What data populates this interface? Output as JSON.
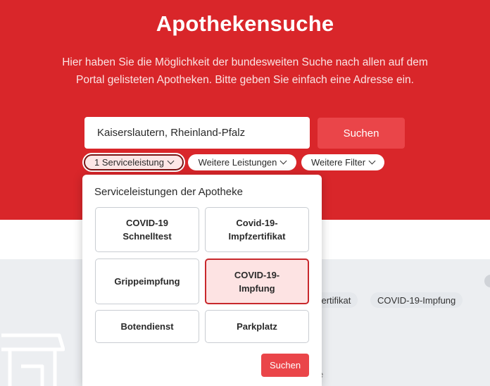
{
  "header": {
    "title": "Apothekensuche",
    "description_line1": "Hier haben Sie die Möglichkeit der bundesweiten Suche nach allen auf dem",
    "description_line2": "Portal gelisteten Apotheken. Bitte geben Sie einfach eine Adresse ein."
  },
  "search": {
    "value": "Kaiserslautern, Rheinland-Pfalz",
    "placeholder": "",
    "button_label": "Suchen"
  },
  "filters": [
    {
      "label": "1 Serviceleistung",
      "active": true,
      "icon": "chevron-down-icon"
    },
    {
      "label": "Weitere Leistungen",
      "active": false,
      "icon": "chevron-down-icon"
    },
    {
      "label": "Weitere Filter",
      "active": false,
      "icon": "chevron-down-icon"
    }
  ],
  "dropdown": {
    "title": "Serviceleistungen der Apotheke",
    "options": [
      {
        "line1": "COVID-19",
        "line2": "Schnelltest",
        "selected": false
      },
      {
        "line1": "Covid-19-",
        "line2": "Impfzertifikat",
        "selected": false
      },
      {
        "line1": "Grippeimpfung",
        "line2": "",
        "selected": false
      },
      {
        "line1": "COVID-19-",
        "line2": "Impfung",
        "selected": true
      },
      {
        "line1": "Botendienst",
        "line2": "",
        "selected": false
      },
      {
        "line1": "Parkplatz",
        "line2": "",
        "selected": false
      }
    ],
    "search_label": "Suchen"
  },
  "background_result": {
    "tags": [
      "zertifikat",
      "COVID-19-Impfung"
    ],
    "partial_text": "e",
    "icon": "storefront-icon"
  },
  "colors": {
    "brand_red": "#d9262a",
    "button_red": "#ea4549",
    "selected_bg": "#fde3e3",
    "selected_border": "#c8282c"
  }
}
